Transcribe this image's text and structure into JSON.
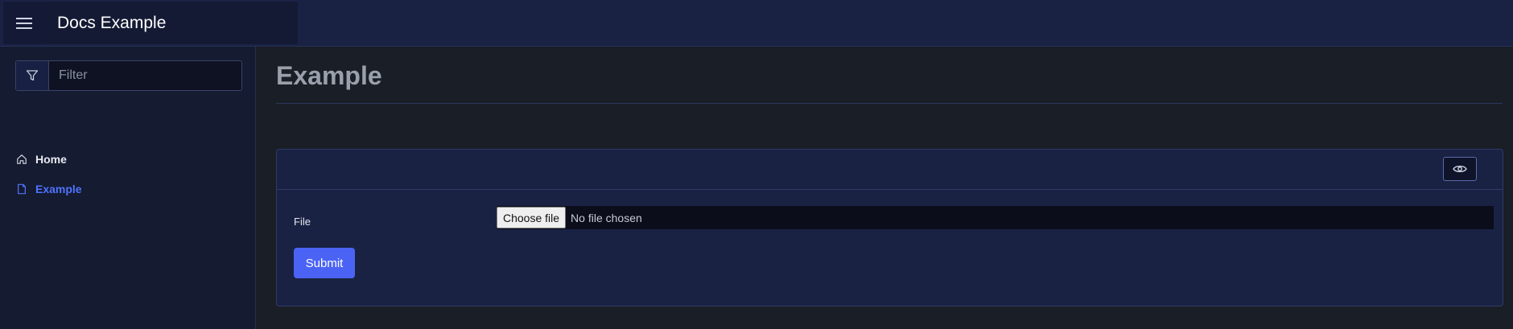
{
  "header": {
    "menu_icon": "hamburger-icon",
    "title": "Docs Example"
  },
  "sidebar": {
    "filter_icon": "filter-icon",
    "filter_placeholder": "Filter",
    "filter_value": "",
    "items": [
      {
        "label": "Home",
        "icon": "home-icon",
        "active": false
      },
      {
        "label": "Example",
        "icon": "document-icon",
        "active": true
      }
    ]
  },
  "main": {
    "title": "Example",
    "card": {
      "toggle_icon": "eye-icon",
      "file_label": "File",
      "choose_file_label": "Choose file",
      "no_file_text": "No file chosen",
      "submit_label": "Submit"
    }
  },
  "colors": {
    "accent": "#4a63f5",
    "active_link": "#4f73ff",
    "topbar": "#1a2244",
    "sidebar": "#151b30",
    "page_bg": "#1a1e26",
    "card_bg": "#1a2244"
  }
}
